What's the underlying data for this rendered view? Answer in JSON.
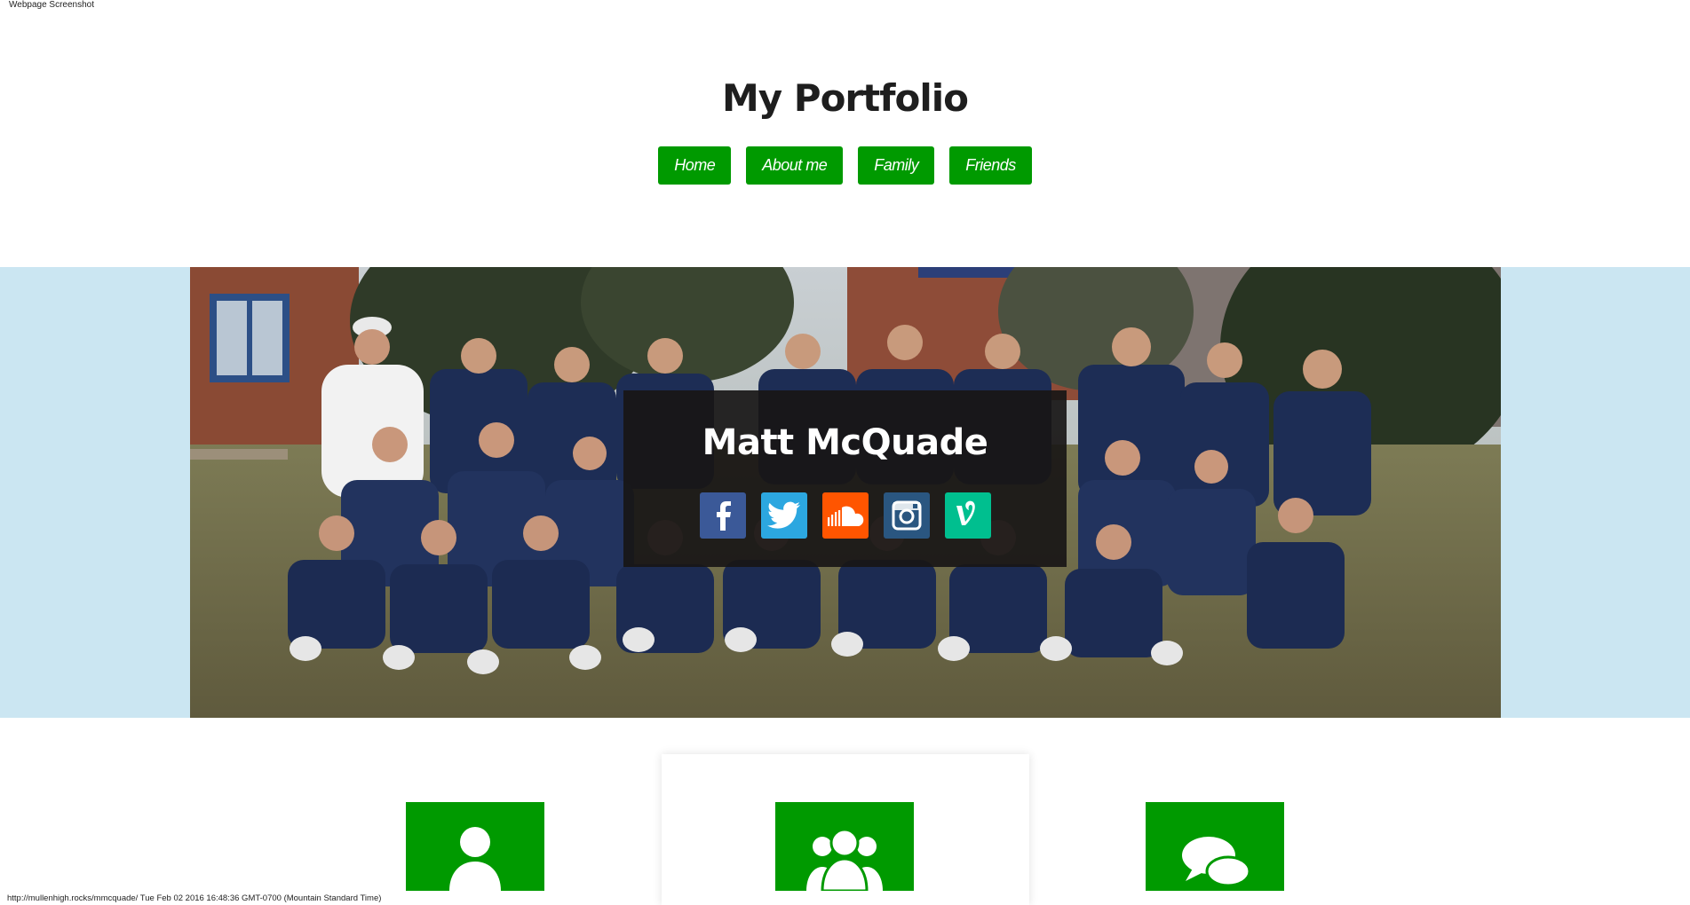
{
  "capture": {
    "header": "Webpage Screenshot",
    "footer": "http://mullenhigh.rocks/mmcquade/ Tue Feb 02 2016 16:48:36 GMT-0700 (Mountain Standard Time)"
  },
  "site": {
    "title": "My Portfolio"
  },
  "nav": {
    "items": [
      "Home",
      "About me",
      "Family",
      "Friends"
    ]
  },
  "hero": {
    "name": "Matt McQuade",
    "socials": [
      {
        "icon": "facebook-icon",
        "color": "#3b5998"
      },
      {
        "icon": "twitter-icon",
        "color": "#2ca7e0"
      },
      {
        "icon": "soundcloud-icon",
        "color": "#ff5500"
      },
      {
        "icon": "instagram-icon",
        "color": "#2a5680"
      },
      {
        "icon": "vine-icon",
        "color": "#00bf8f"
      }
    ]
  },
  "features": [
    {
      "icon": "person-icon",
      "color": "#009a00"
    },
    {
      "icon": "group-icon",
      "color": "#009a00"
    },
    {
      "icon": "chat-bubbles-icon",
      "color": "#009a00"
    }
  ],
  "colors": {
    "accent": "#009a00",
    "hero_band": "#cbe6f2",
    "card": "#181616"
  }
}
